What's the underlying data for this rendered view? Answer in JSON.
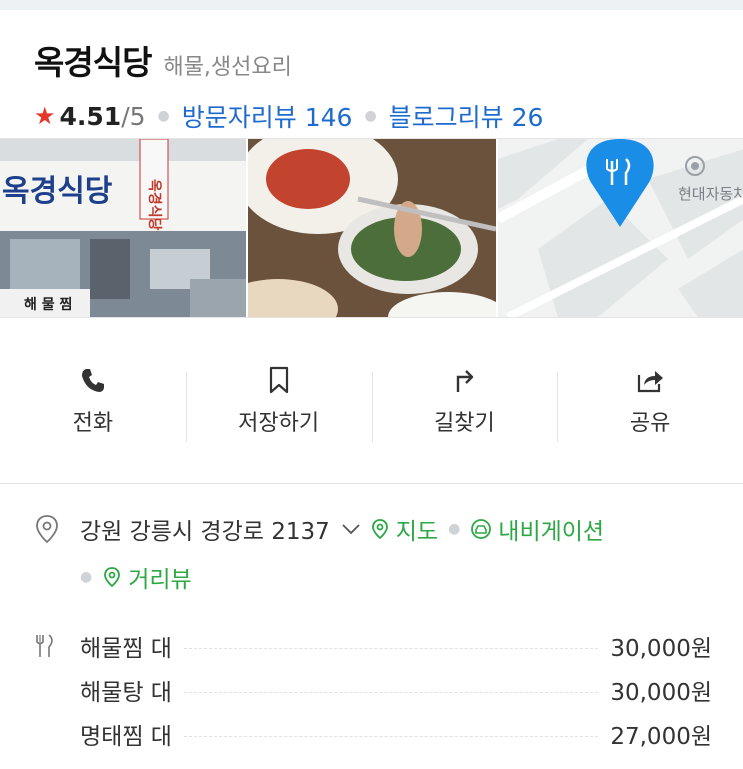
{
  "place": {
    "name": "옥경식당",
    "category": "해물,생선요리",
    "rating": "4.51",
    "rating_max": "/5",
    "visitor_reviews": "방문자리뷰 146",
    "blog_reviews": "블로그리뷰 26"
  },
  "photos": {
    "storefront_sign": "옥경식당",
    "storefront_sub": "해물찜",
    "map_label": "현대자동차"
  },
  "actions": [
    {
      "label": "전화",
      "icon": "phone-icon"
    },
    {
      "label": "저장하기",
      "icon": "bookmark-icon"
    },
    {
      "label": "길찾기",
      "icon": "directions-icon"
    },
    {
      "label": "공유",
      "icon": "share-icon"
    }
  ],
  "address": {
    "text": "강원 강릉시 경강로 2137",
    "map": "지도",
    "navigation": "내비게이션",
    "street_view": "거리뷰"
  },
  "menu": [
    {
      "name": "해물찜 대",
      "price": "30,000원"
    },
    {
      "name": "해물탕 대",
      "price": "30,000원"
    },
    {
      "name": "명태찜 대",
      "price": "27,000원"
    }
  ],
  "colors": {
    "link_blue": "#1e6bd0",
    "green": "#2ea844",
    "star_red": "#e5362a",
    "map_pin_blue": "#1a8de6"
  }
}
